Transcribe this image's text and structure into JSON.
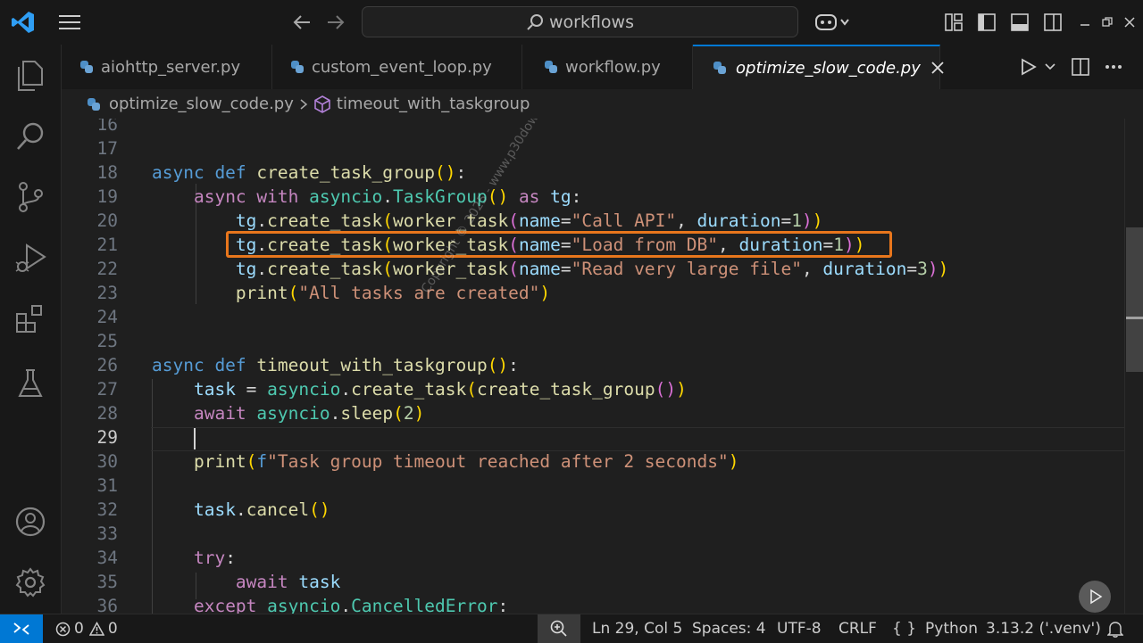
{
  "titlebar": {
    "search_text": "workflows"
  },
  "tabs": [
    {
      "label": "aiohttp_server.py"
    },
    {
      "label": "custom_event_loop.py"
    },
    {
      "label": "workflow.py"
    },
    {
      "label": "optimize_slow_code.py"
    }
  ],
  "breadcrumb": {
    "file": "optimize_slow_code.py",
    "symbol": "timeout_with_taskgroup"
  },
  "editor": {
    "line_numbers": [
      "16",
      "17",
      "18",
      "19",
      "20",
      "21",
      "22",
      "23",
      "24",
      "25",
      "26",
      "27",
      "28",
      "29",
      "30",
      "31",
      "32",
      "33",
      "34",
      "35",
      "36"
    ],
    "strings": {
      "call_api": "\"Call API\"",
      "load_db": "\"Load from DB\"",
      "read_file": "\"Read very large file\"",
      "tasks_created": "\"All tasks are created\"",
      "timeout_msg": "\"Task group timeout reached after 2 seconds\""
    },
    "watermark": "Copyright © 2025 - www.p30download.com",
    "highlight_color": "#e8761c"
  },
  "statusbar": {
    "errors": "0",
    "warnings": "0",
    "position": "Ln 29, Col 5",
    "spaces": "Spaces: 4",
    "encoding": "UTF-8",
    "eol": "CRLF",
    "language": "Python",
    "interpreter": "3.13.2 ('.venv')"
  },
  "colors": {
    "accent": "#0078d4",
    "remote": "#0078d4"
  }
}
